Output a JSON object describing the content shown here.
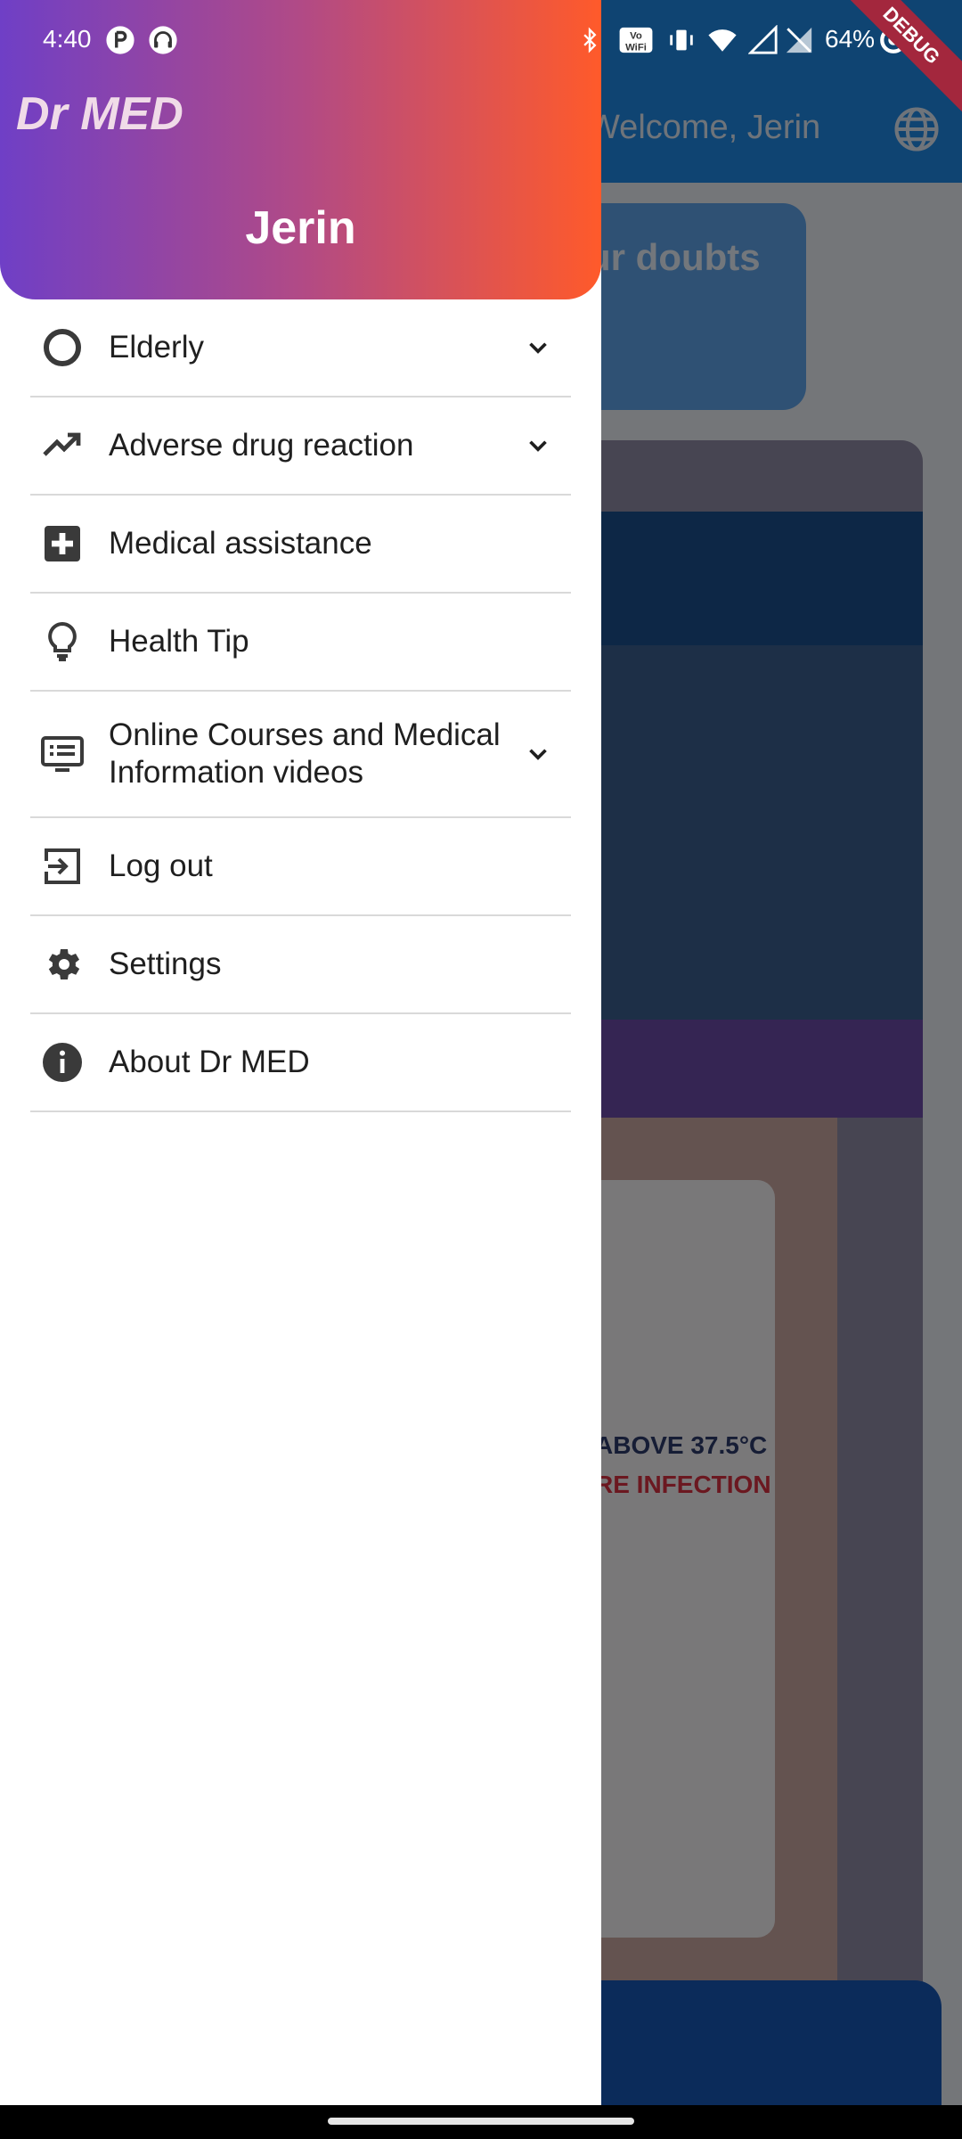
{
  "status_bar": {
    "time": "4:40",
    "battery": "64%",
    "debug_banner": "DEBUG"
  },
  "background": {
    "welcome_text": "Welcome, Jerin",
    "doubts_text": "ur doubts",
    "poster_line1": "ABOVE 37.5°C",
    "poster_line2": "RE INFECTION"
  },
  "drawer": {
    "brand": "Dr MED",
    "username": "Jerin",
    "items": [
      {
        "label": "Elderly",
        "icon": "circle-outline-icon",
        "expandable": true
      },
      {
        "label": "Adverse drug reaction",
        "icon": "trending-up-icon",
        "expandable": true
      },
      {
        "label": "Medical assistance",
        "icon": "medical-cross-icon",
        "expandable": false
      },
      {
        "label": "Health Tip",
        "icon": "lightbulb-icon",
        "expandable": false
      },
      {
        "label": "Online Courses and Medical Information videos",
        "icon": "video-list-icon",
        "expandable": true
      },
      {
        "label": "Log out",
        "icon": "logout-icon",
        "expandable": false
      },
      {
        "label": "Settings",
        "icon": "gear-icon",
        "expandable": false
      },
      {
        "label": "About Dr MED",
        "icon": "info-icon",
        "expandable": false
      }
    ]
  },
  "colors": {
    "header_gradient_start": "#6f3fc6",
    "header_gradient_end": "#ff5a2a",
    "appbar": "#1e88e5",
    "debug_banner": "#a3273d"
  }
}
